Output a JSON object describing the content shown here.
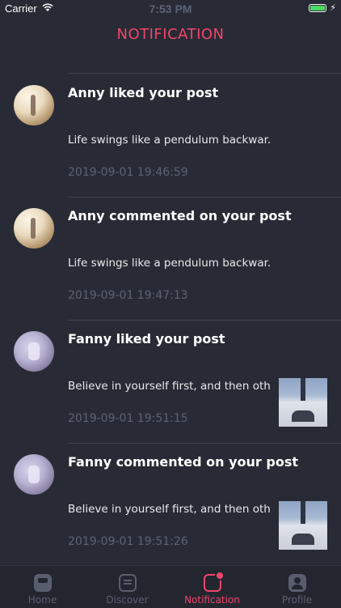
{
  "status_bar": {
    "carrier": "Carrier",
    "time": "7:53 PM"
  },
  "nav": {
    "title": "NOTIFICATION"
  },
  "notifications": [
    {
      "title": "Anny liked your post",
      "preview": "Life swings like a pendulum backwar...",
      "time": "2019-09-01 19:46:59",
      "avatar": "anny",
      "has_thumbnail": false
    },
    {
      "title": "Anny commented on your post",
      "preview": "Life swings like a pendulum backwar...",
      "time": "2019-09-01 19:47:13",
      "avatar": "anny",
      "has_thumbnail": false
    },
    {
      "title": "Fanny liked your post",
      "preview": "Believe in yourself first, and then oth...",
      "time": "2019-09-01 19:51:15",
      "avatar": "fanny",
      "has_thumbnail": true
    },
    {
      "title": "Fanny commented on your post",
      "preview": "Believe in yourself first, and then oth...",
      "time": "2019-09-01 19:51:26",
      "avatar": "fanny",
      "has_thumbnail": true
    }
  ],
  "tab_bar": {
    "tabs": [
      {
        "label": "Home",
        "icon": "home-icon",
        "active": false
      },
      {
        "label": "Discover",
        "icon": "discover-icon",
        "active": false
      },
      {
        "label": "Notification",
        "icon": "notification-icon",
        "active": true
      },
      {
        "label": "Profile",
        "icon": "profile-icon",
        "active": false
      }
    ]
  },
  "colors": {
    "background": "#282b35",
    "accent": "#f0456a",
    "muted_text": "#5d6375"
  }
}
